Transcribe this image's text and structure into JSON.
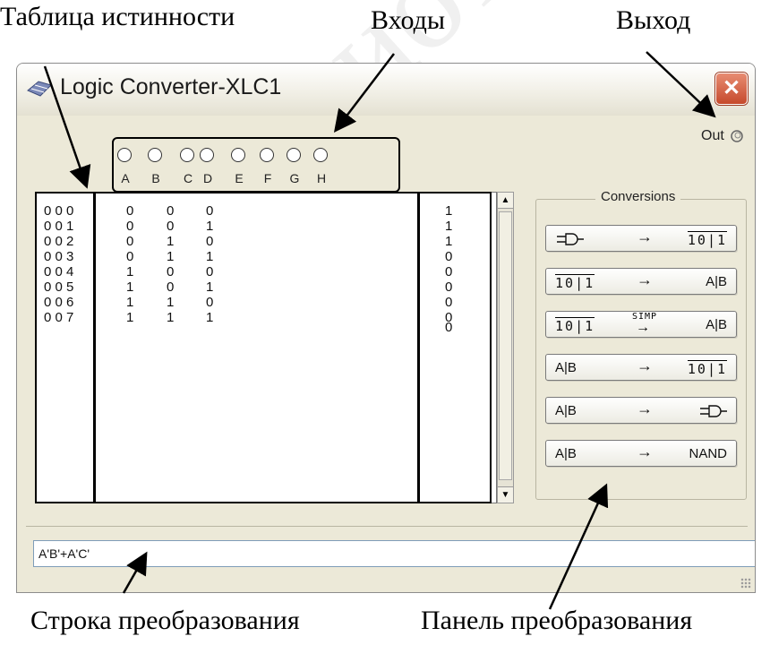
{
  "captions": {
    "truth_table": "Таблица истинности",
    "inputs": "Входы",
    "output": "Выход",
    "conversion_string": "Строка преобразования",
    "conversion_panel": "Панель преобразования"
  },
  "watermark": "Библиотека БГУИР",
  "window": {
    "title": "Logic Converter-XLC1",
    "close_glyph": "✕"
  },
  "out_label": "Out",
  "inputs": [
    "A",
    "B",
    "C",
    "D",
    "E",
    "F",
    "G",
    "H"
  ],
  "truth_table": {
    "rows": [
      {
        "index": "0 0 0",
        "a": "0",
        "b": "0",
        "c": "0",
        "out": "1"
      },
      {
        "index": "0 0 1",
        "a": "0",
        "b": "0",
        "c": "1",
        "out": "1"
      },
      {
        "index": "0 0 2",
        "a": "0",
        "b": "1",
        "c": "0",
        "out": "1"
      },
      {
        "index": "0 0 3",
        "a": "0",
        "b": "1",
        "c": "1",
        "out": "0"
      },
      {
        "index": "0 0 4",
        "a": "1",
        "b": "0",
        "c": "0",
        "out": "0"
      },
      {
        "index": "0 0 5",
        "a": "1",
        "b": "0",
        "c": "1",
        "out": "0"
      },
      {
        "index": "0 0 6",
        "a": "1",
        "b": "1",
        "c": "0",
        "out": "0"
      },
      {
        "index": "0 0 7",
        "a": "1",
        "b": "1",
        "c": "1",
        "out": "0"
      }
    ],
    "extra_out": "0"
  },
  "scrollbar": {
    "up": "▲",
    "down": "▼"
  },
  "conversions": {
    "title": "Conversions",
    "arrow": "→",
    "simp_label": "SIMP",
    "truth_glyph": [
      "1",
      "0",
      "1"
    ],
    "expr_label": "A|B",
    "nand_label": "NAND",
    "gate_icon": "gate-icon"
  },
  "expression": "A'B'+A'C'"
}
